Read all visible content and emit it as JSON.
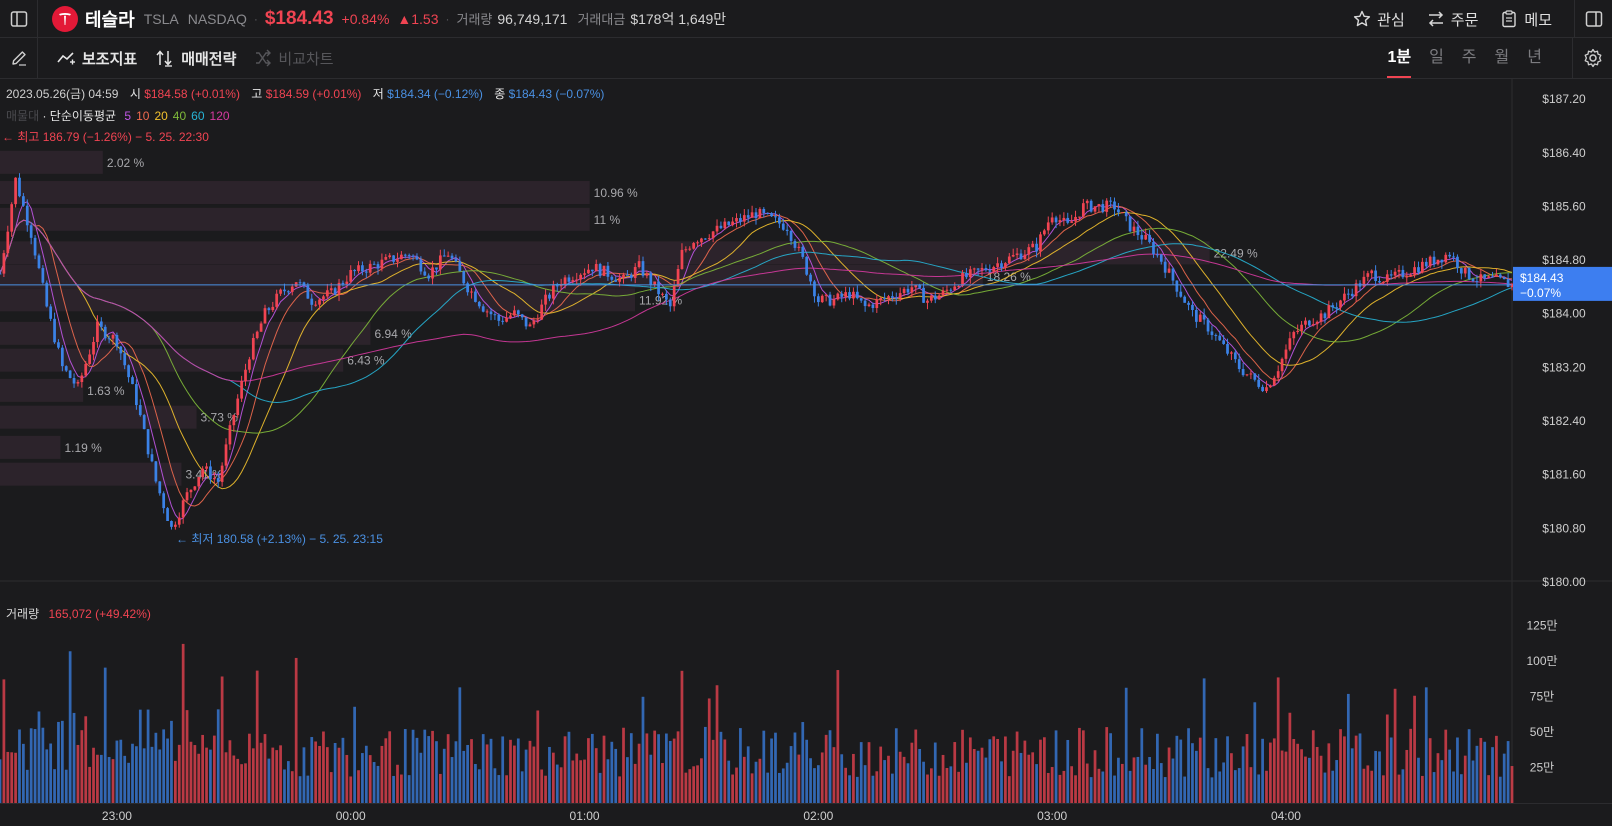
{
  "header": {
    "stock_name": "테슬라",
    "ticker": "TSLA",
    "exchange": "NASDAQ",
    "price": "$184.43",
    "change_pct": "+0.84%",
    "change_abs": "▲1.53",
    "volume_label": "거래량",
    "volume_value": "96,749,171",
    "turnover_label": "거래대금",
    "turnover_value": "$178억 1,649만",
    "watch_label": "관심",
    "order_label": "주문",
    "memo_label": "메모"
  },
  "toolbar": {
    "indicators_label": "보조지표",
    "strategy_label": "매매전략",
    "compare_label": "비교차트",
    "periods": [
      "1분",
      "일",
      "주",
      "월",
      "년"
    ],
    "active_period": "1분"
  },
  "info": {
    "datetime": "2023.05.26(금) 04:59",
    "open_label": "시",
    "open_value": "$184.58 (+0.01%)",
    "high_label": "고",
    "high_value": "$184.59 (+0.01%)",
    "low_label": "저",
    "low_value": "$184.34 (−0.12%)",
    "close_label": "종",
    "close_value": "$184.43 (−0.07%)",
    "ma_prefix": "매물대",
    "ma_title": "· 단순이동평균",
    "ma_periods": [
      "5",
      "10",
      "20",
      "40",
      "60",
      "120"
    ],
    "ma_colors": [
      "#c156e8",
      "#f06a4f",
      "#f2c12e",
      "#7fba3a",
      "#27b4d6",
      "#d63aa0"
    ],
    "high_marker": "← 최고 186.79 (−1.26%) − 5. 25. 22:30",
    "low_marker": "← 최저 180.58 (+2.13%) − 5. 25. 23:15",
    "last_price_tag": "$184.43",
    "last_change_tag": "−0.07%"
  },
  "volume_panel": {
    "label": "거래량",
    "value": "165,072 (+49.42%)"
  },
  "colors": {
    "up": "#f04452",
    "down": "#3b82e6",
    "accent_tag": "#3d7ef0"
  },
  "chart_data": {
    "type": "candlestick",
    "interval": "1분",
    "x_ticks": [
      "23:00",
      "00:00",
      "01:00",
      "02:00",
      "03:00",
      "04:00"
    ],
    "x_tick_minutes": [
      30,
      90,
      150,
      210,
      270,
      330
    ],
    "x_range_minutes": [
      0,
      388
    ],
    "y_range": [
      180.0,
      187.5
    ],
    "y_ticks": [
      187.2,
      186.4,
      185.6,
      184.8,
      184.0,
      183.2,
      182.4,
      181.6,
      180.8,
      180.0
    ],
    "y_tick_labels": [
      "$187.20",
      "$186.40",
      "$185.60",
      "$184.80",
      "$184.00",
      "$183.20",
      "$182.40",
      "$181.60",
      "$180.80",
      "$180.00"
    ],
    "last_price": 184.43,
    "price_path": [
      [
        0,
        184.6
      ],
      [
        4,
        186.0
      ],
      [
        8,
        185.2
      ],
      [
        12,
        184.1
      ],
      [
        16,
        183.2
      ],
      [
        20,
        182.9
      ],
      [
        25,
        183.8
      ],
      [
        30,
        183.6
      ],
      [
        35,
        182.7
      ],
      [
        40,
        181.5
      ],
      [
        44,
        180.8
      ],
      [
        48,
        181.3
      ],
      [
        52,
        181.7
      ],
      [
        56,
        181.5
      ],
      [
        60,
        182.5
      ],
      [
        64,
        183.4
      ],
      [
        68,
        184.0
      ],
      [
        72,
        184.3
      ],
      [
        76,
        184.5
      ],
      [
        80,
        184.2
      ],
      [
        85,
        184.3
      ],
      [
        90,
        184.6
      ],
      [
        95,
        184.7
      ],
      [
        100,
        184.8
      ],
      [
        105,
        184.9
      ],
      [
        110,
        184.6
      ],
      [
        115,
        184.9
      ],
      [
        120,
        184.4
      ],
      [
        124,
        184.1
      ],
      [
        128,
        183.9
      ],
      [
        132,
        184.0
      ],
      [
        136,
        183.8
      ],
      [
        140,
        184.2
      ],
      [
        144,
        184.5
      ],
      [
        148,
        184.6
      ],
      [
        152,
        184.7
      ],
      [
        156,
        184.6
      ],
      [
        160,
        184.5
      ],
      [
        164,
        184.7
      ],
      [
        168,
        184.4
      ],
      [
        172,
        184.1
      ],
      [
        175,
        184.9
      ],
      [
        178,
        185.1
      ],
      [
        182,
        185.2
      ],
      [
        186,
        185.3
      ],
      [
        190,
        185.4
      ],
      [
        194,
        185.5
      ],
      [
        198,
        185.4
      ],
      [
        202,
        185.3
      ],
      [
        206,
        184.8
      ],
      [
        210,
        184.2
      ],
      [
        214,
        184.2
      ],
      [
        218,
        184.3
      ],
      [
        222,
        184.1
      ],
      [
        226,
        184.2
      ],
      [
        230,
        184.3
      ],
      [
        234,
        184.4
      ],
      [
        238,
        184.2
      ],
      [
        242,
        184.3
      ],
      [
        246,
        184.5
      ],
      [
        250,
        184.6
      ],
      [
        254,
        184.7
      ],
      [
        258,
        184.8
      ],
      [
        262,
        184.9
      ],
      [
        266,
        185.0
      ],
      [
        270,
        185.5
      ],
      [
        274,
        185.3
      ],
      [
        278,
        185.6
      ],
      [
        282,
        185.6
      ],
      [
        286,
        185.6
      ],
      [
        290,
        185.3
      ],
      [
        294,
        185.1
      ],
      [
        298,
        184.8
      ],
      [
        302,
        184.4
      ],
      [
        306,
        184.0
      ],
      [
        310,
        183.8
      ],
      [
        314,
        183.5
      ],
      [
        318,
        183.2
      ],
      [
        322,
        183.0
      ],
      [
        325,
        182.9
      ],
      [
        328,
        183.2
      ],
      [
        332,
        183.7
      ],
      [
        336,
        183.9
      ],
      [
        340,
        184.0
      ],
      [
        344,
        184.2
      ],
      [
        348,
        184.4
      ],
      [
        352,
        184.6
      ],
      [
        356,
        184.5
      ],
      [
        360,
        184.6
      ],
      [
        364,
        184.7
      ],
      [
        368,
        184.8
      ],
      [
        372,
        184.9
      ],
      [
        376,
        184.6
      ],
      [
        380,
        184.5
      ],
      [
        384,
        184.5
      ],
      [
        388,
        184.43
      ]
    ],
    "ma_smoothing": [
      5,
      10,
      20,
      40,
      60,
      120
    ],
    "volume_profile": [
      {
        "price": 186.25,
        "pct": "2.02 %",
        "width": 0.068
      },
      {
        "price": 185.8,
        "pct": "10.96 %",
        "width": 0.39
      },
      {
        "price": 185.4,
        "pct": "11 %",
        "width": 0.39
      },
      {
        "price": 184.9,
        "pct": "22.49 %",
        "width": 0.8
      },
      {
        "price": 184.55,
        "pct": "18.26 %",
        "width": 0.65
      },
      {
        "price": 184.2,
        "pct": "11.92 %",
        "width": 0.42
      },
      {
        "price": 183.7,
        "pct": "6.94 %",
        "width": 0.245
      },
      {
        "price": 183.3,
        "pct": "6.43 %",
        "width": 0.227
      },
      {
        "price": 182.85,
        "pct": "1.63 %",
        "width": 0.055
      },
      {
        "price": 182.45,
        "pct": "3.73 %",
        "width": 0.13
      },
      {
        "price": 182.0,
        "pct": "1.19 %",
        "width": 0.04
      },
      {
        "price": 181.6,
        "pct": "3.41 %",
        "width": 0.12
      }
    ],
    "volume_axis_labels": [
      "125만",
      "100만",
      "75만",
      "50만",
      "25만"
    ],
    "volume_axis_values": [
      1250000,
      1000000,
      750000,
      500000,
      250000
    ],
    "volume_max": 1400000
  }
}
